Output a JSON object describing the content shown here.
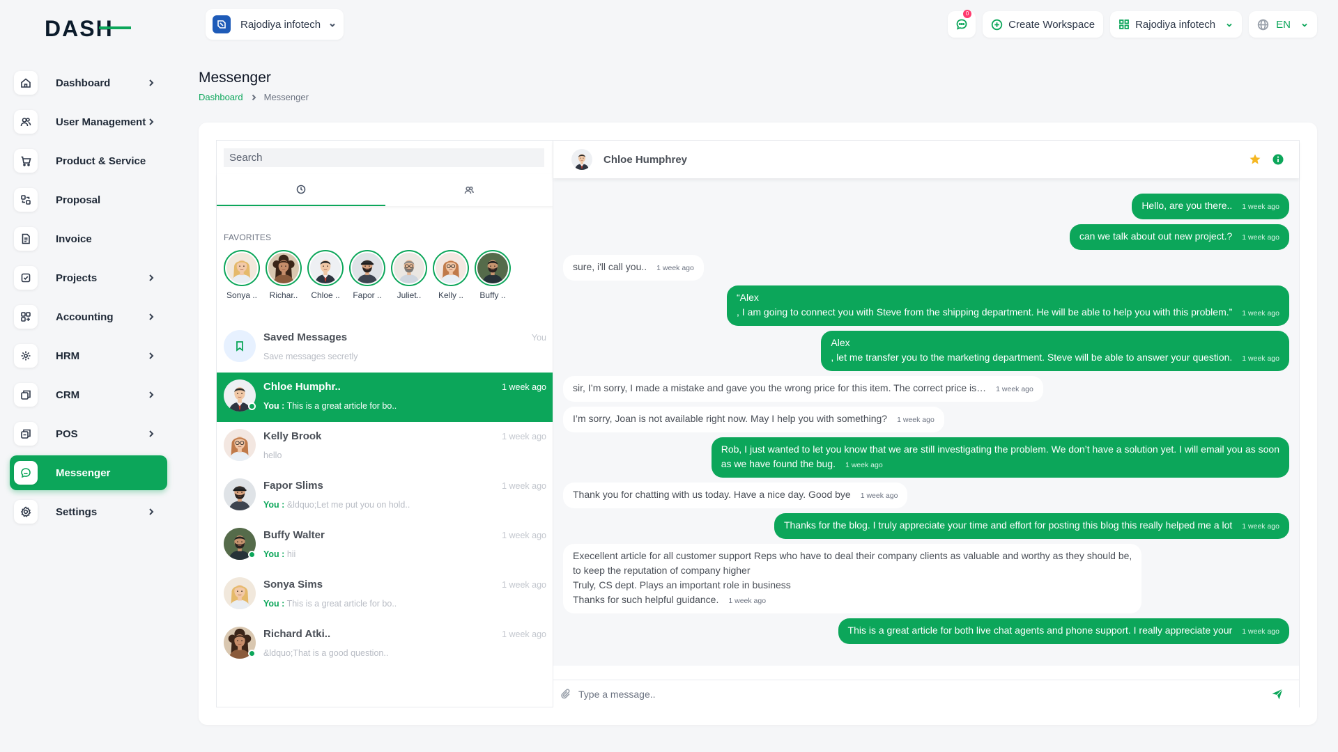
{
  "brand": {
    "logo_text": "DASH",
    "accent": "#0ca65a"
  },
  "sidebar": {
    "items": [
      {
        "label": "Dashboard",
        "icon": "home-icon",
        "chevron": true
      },
      {
        "label": "User Management",
        "icon": "users-icon",
        "chevron": true
      },
      {
        "label": "Product & Service",
        "icon": "cart-icon",
        "chevron": false
      },
      {
        "label": "Proposal",
        "icon": "proposal-icon",
        "chevron": false
      },
      {
        "label": "Invoice",
        "icon": "invoice-icon",
        "chevron": false
      },
      {
        "label": "Projects",
        "icon": "projects-icon",
        "chevron": true
      },
      {
        "label": "Accounting",
        "icon": "accounting-icon",
        "chevron": true
      },
      {
        "label": "HRM",
        "icon": "hrm-icon",
        "chevron": true
      },
      {
        "label": "CRM",
        "icon": "crm-icon",
        "chevron": true
      },
      {
        "label": "POS",
        "icon": "pos-icon",
        "chevron": true
      },
      {
        "label": "Messenger",
        "icon": "messenger-icon",
        "chevron": false,
        "active": true
      },
      {
        "label": "Settings",
        "icon": "settings-icon",
        "chevron": true
      }
    ]
  },
  "topbar": {
    "workspace_name": "Rajodiya infotech",
    "notification_count": "0",
    "create_workspace_label": "Create Workspace",
    "workspace_switcher_label": "Rajodiya infotech",
    "language": "EN"
  },
  "header": {
    "title": "Messenger",
    "breadcrumb": {
      "home": "Dashboard",
      "current": "Messenger"
    }
  },
  "contacts_panel": {
    "search_placeholder": "Search",
    "favorites_title": "FAVORITES",
    "favorites": [
      {
        "name": "Sonya ..",
        "avatar": "woman-blonde"
      },
      {
        "name": "Richar..",
        "avatar": "woman-curly"
      },
      {
        "name": "Chloe ..",
        "avatar": "man-suit"
      },
      {
        "name": "Fapor ..",
        "avatar": "man-cap"
      },
      {
        "name": "Juliet..",
        "avatar": "man-glasses"
      },
      {
        "name": "Kelly ..",
        "avatar": "woman-glasses"
      },
      {
        "name": "Buffy ..",
        "avatar": "man-beard"
      }
    ],
    "saved": {
      "title": "Saved Messages",
      "subtitle": "Save messages secretly",
      "time": "You"
    },
    "conversations": [
      {
        "name": "Chloe Humphr..",
        "time": "1 week ago",
        "you": true,
        "preview": "This is a great article for bo..",
        "online": true,
        "active": true,
        "avatar": "man-suit"
      },
      {
        "name": "Kelly Brook",
        "time": "1 week ago",
        "you": false,
        "preview": "hello",
        "online": false,
        "avatar": "woman-glasses"
      },
      {
        "name": "Fapor Slims",
        "time": "1 week ago",
        "you": true,
        "preview": "&ldquo;Let me put you on hold..",
        "online": false,
        "avatar": "man-cap"
      },
      {
        "name": "Buffy Walter",
        "time": "1 week ago",
        "you": true,
        "preview": "hii",
        "online": true,
        "avatar": "man-beard"
      },
      {
        "name": "Sonya Sims",
        "time": "1 week ago",
        "you": true,
        "preview": "This is a great article for bo..",
        "online": false,
        "avatar": "woman-blonde"
      },
      {
        "name": "Richard Atki..",
        "time": "1 week ago",
        "you": false,
        "preview": "&ldquo;That is a good question..",
        "online": true,
        "avatar": "woman-curly"
      }
    ],
    "you_label": "You :"
  },
  "chat": {
    "contact_name": "Chloe Humphrey",
    "input_placeholder": "Type a message..",
    "messages": [
      {
        "from": "me",
        "lines": [
          "Hello, are you there.."
        ],
        "time": "1 week ago"
      },
      {
        "from": "me",
        "lines": [
          "can we talk about out new project.?"
        ],
        "time": "1 week ago"
      },
      {
        "from": "them",
        "lines": [
          "sure, i'll call you.."
        ],
        "time": "1 week ago"
      },
      {
        "from": "me",
        "lines": [
          "“Alex",
          ", I am going to connect you with Steve from the shipping department. He will be able to help you with this problem.”"
        ],
        "time": "1 week ago"
      },
      {
        "from": "me",
        "lines": [
          "Alex",
          ", let me transfer you to the marketing department. Steve will be able to answer your question."
        ],
        "time": "1 week ago"
      },
      {
        "from": "them",
        "lines": [
          "sir, I’m sorry, I made a mistake and gave you the wrong price for this item. The correct price is…"
        ],
        "time": "1 week ago"
      },
      {
        "from": "them",
        "lines": [
          "I’m sorry, Joan is not available right now. May I help you with something?"
        ],
        "time": "1 week ago"
      },
      {
        "from": "me",
        "lines": [
          "Rob, I just wanted to let you know that we are still investigating the problem. We don’t have a solution yet. I will email you as soon",
          "as we have found the bug."
        ],
        "time": "1 week ago"
      },
      {
        "from": "them",
        "lines": [
          "Thank you for chatting with us today. Have a nice day. Good bye"
        ],
        "time": "1 week ago"
      },
      {
        "from": "me",
        "lines": [
          "Thanks for the blog. I truly appreciate your time and effort for posting this blog this really helped me a lot"
        ],
        "time": "1 week ago"
      },
      {
        "from": "them",
        "lines": [
          "Execellent article for all customer support Reps who have to deal their company clients as valuable and worthy as they should be,",
          "to keep the reputation of company higher",
          "Truly, CS dept. Plays an important role in business",
          "Thanks for such helpful guidance."
        ],
        "time": "1 week ago"
      },
      {
        "from": "me",
        "lines": [
          "This is a great article for both live chat agents and phone support. I really appreciate your"
        ],
        "time": "1 week ago"
      }
    ]
  }
}
